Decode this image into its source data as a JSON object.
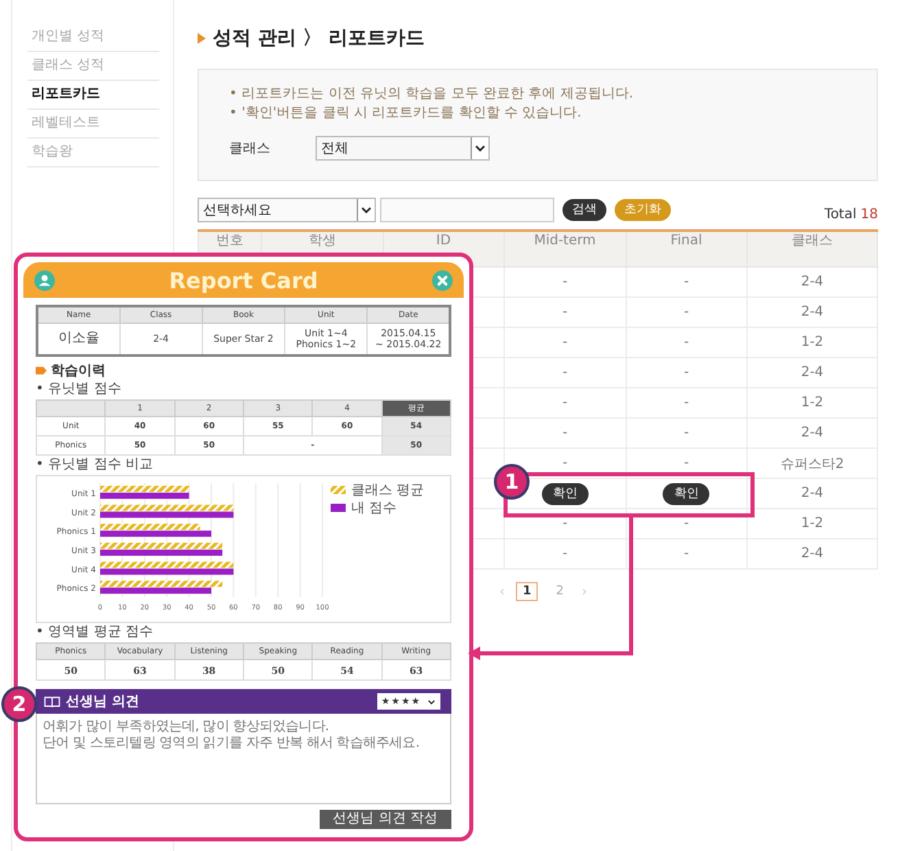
{
  "sidebar": {
    "items": [
      {
        "label": "개인별 성적",
        "selected": false
      },
      {
        "label": "클래스 성적",
        "selected": false
      },
      {
        "label": "리포트카드",
        "selected": true
      },
      {
        "label": "레벨테스트",
        "selected": false
      },
      {
        "label": "학습왕",
        "selected": false
      }
    ]
  },
  "page_title": "성적 관리 〉 리포트카드",
  "notice": {
    "lines": [
      "• 리포트카드는 이전 유닛의 학습을 모두 완료한 후에 제공됩니다.",
      "• '확인'버튼을 클릭 시 리포트카드를 확인할 수 있습니다."
    ],
    "class_filter": {
      "label": "클래스",
      "value": "전체"
    }
  },
  "search": {
    "category": "선택하세요",
    "buttons": [
      {
        "kind": "search",
        "label": "검색"
      },
      {
        "kind": "reset",
        "label": "초기화"
      }
    ],
    "total_label": "Total",
    "total_count": "18"
  },
  "table": {
    "columns": [
      "번호",
      "학생",
      "ID",
      "Mid-term",
      "Final",
      "클래스"
    ],
    "rows": [
      {
        "kind": "text",
        "mid_term": "-",
        "final": "-",
        "class": "2-4"
      },
      {
        "kind": "text",
        "mid_term": "-",
        "final": "-",
        "class": "2-4"
      },
      {
        "kind": "text",
        "mid_term": "-",
        "final": "-",
        "class": "1-2"
      },
      {
        "kind": "text",
        "mid_term": "-",
        "final": "-",
        "class": "2-4"
      },
      {
        "kind": "text",
        "mid_term": "-",
        "final": "-",
        "class": "1-2"
      },
      {
        "kind": "text",
        "mid_term": "-",
        "final": "-",
        "class": "2-4"
      },
      {
        "kind": "text",
        "mid_term": "-",
        "final": "-",
        "class": "슈퍼스타2"
      },
      {
        "kind": "confirm",
        "mid_term": "확인",
        "final": "확인",
        "class": "2-4"
      },
      {
        "kind": "text",
        "mid_term": "-",
        "final": "-",
        "class": "1-2"
      },
      {
        "kind": "text",
        "mid_term": "-",
        "final": "-",
        "class": "2-4"
      }
    ]
  },
  "pagination": {
    "prev": "‹",
    "pages": [
      {
        "label": "1",
        "selected": true
      },
      {
        "label": "2",
        "selected": false
      }
    ],
    "next": "›"
  },
  "report_card": {
    "title": "Report Card",
    "info": {
      "columns": [
        "Name",
        "Class",
        "Book",
        "Unit",
        "Date"
      ],
      "values": [
        "이소율",
        "2-4",
        "Super Star 2",
        "Unit 1~4\nPhonics 1~2",
        "2015.04.15\n~ 2015.04.22"
      ]
    },
    "section_title": "학습이력",
    "unit_scores": {
      "heading": "• 유닛별 점수",
      "columns": [
        "1",
        "2",
        "3",
        "4",
        "평균"
      ],
      "rows": [
        {
          "label": "Unit",
          "values": [
            "40",
            "60",
            "55",
            "60"
          ],
          "average": "54"
        },
        {
          "label": "Phonics",
          "values": [
            "50",
            "50",
            "-"
          ],
          "average": "50"
        }
      ]
    },
    "comparison": {
      "heading": "• 유닛별 점수 비교",
      "chart_data": {
        "type": "bar",
        "orientation": "horizontal",
        "categories": [
          "Unit 1",
          "Unit 2",
          "Phonics 1",
          "Unit 3",
          "Unit 4",
          "Phonics 2"
        ],
        "series": [
          {
            "name": "클래스 평균",
            "color": "#e8b820",
            "values": [
              40,
              60,
              45,
              55,
              60,
              55
            ]
          },
          {
            "name": "내 점수",
            "color": "#9a1fc4",
            "values": [
              40,
              60,
              50,
              55,
              60,
              50
            ]
          }
        ],
        "xlim": [
          0,
          100
        ],
        "xticks": [
          0,
          10,
          20,
          30,
          40,
          50,
          60,
          70,
          80,
          90,
          100
        ],
        "grid": true,
        "legend": true
      }
    },
    "area_scores": {
      "heading": "• 영역별 평균 점수",
      "columns": [
        "Phonics",
        "Vocabulary",
        "Listening",
        "Speaking",
        "Reading",
        "Writing"
      ],
      "values": [
        "50",
        "63",
        "38",
        "50",
        "54",
        "63"
      ]
    },
    "teacher_comment": {
      "title": "선생님 의견",
      "rating": "★★★★",
      "lines": [
        "어휘가 많이 부족하였는데, 많이 향상되었습니다.",
        "단어 및 스토리텔링 영역의 읽기를 자주 반복 해서 학습해주세요."
      ],
      "button": "선생님 의견 작성"
    }
  },
  "annotations": [
    {
      "kind": "table_highlight",
      "label": "1"
    },
    {
      "kind": "card_badge",
      "label": "2"
    }
  ]
}
